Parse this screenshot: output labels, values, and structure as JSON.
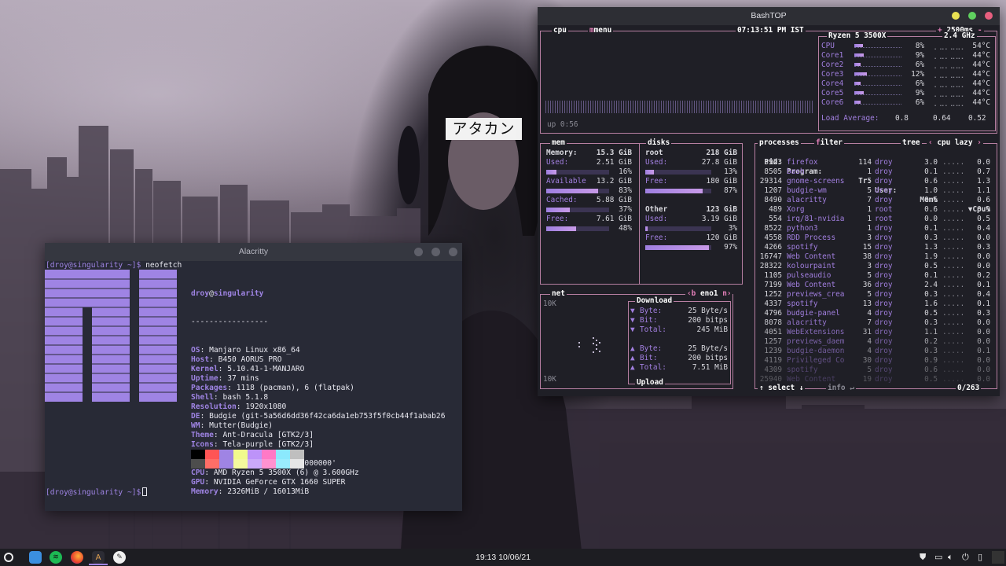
{
  "wallpaper": {
    "tag_text": "アタカン"
  },
  "alacritty": {
    "title": "Alacritty",
    "prompt1": "[droy@singularity ~]$",
    "command": " neofetch",
    "user": "droy",
    "at": "@",
    "host": "singularity",
    "separator": "-----------------",
    "info": [
      {
        "key": "OS",
        "value": "Manjaro Linux x86_64"
      },
      {
        "key": "Host",
        "value": "B450 AORUS PRO"
      },
      {
        "key": "Kernel",
        "value": "5.10.41-1-MANJARO"
      },
      {
        "key": "Uptime",
        "value": "37 mins"
      },
      {
        "key": "Packages",
        "value": "1118 (pacman), 6 (flatpak)"
      },
      {
        "key": "Shell",
        "value": "bash 5.1.8"
      },
      {
        "key": "Resolution",
        "value": "1920x1080"
      },
      {
        "key": "DE",
        "value": "Budgie (git-5a56d6dd36f42ca6da1eb753f5f0cb44f1abab26"
      },
      {
        "key": "WM",
        "value": "Mutter(Budgie)"
      },
      {
        "key": "Theme",
        "value": "Ant-Dracula [GTK2/3]"
      },
      {
        "key": "Icons",
        "value": "Tela-purple [GTK2/3]"
      },
      {
        "key": "Terminal",
        "value": "alacritty"
      },
      {
        "key": "Terminal Font",
        "value": "black: '0x000000'"
      },
      {
        "key": "CPU",
        "value": "AMD Ryzen 5 3500X (6) @ 3.600GHz"
      },
      {
        "key": "GPU",
        "value": "NVIDIA GeForce GTX 1660 SUPER"
      },
      {
        "key": "Memory",
        "value": "2326MiB / 16013MiB"
      }
    ],
    "palette_top": [
      "#000000",
      "#ff5555",
      "#9f84e4",
      "#f1fa8c",
      "#bd93f9",
      "#ff79c6",
      "#8be9fd",
      "#bfbfbf"
    ],
    "palette_bottom": [
      "#4d4d4d",
      "#ff6e67",
      "#9f84e4",
      "#f4f99d",
      "#caa9fa",
      "#ff92d0",
      "#9aedfe",
      "#e6e6e6"
    ],
    "prompt2": "[droy@singularity ~]$"
  },
  "bashtop": {
    "title": "BashTOP",
    "cpu_label": "cpu",
    "menu_label": "menu",
    "clock": "07:13:51 PM IST",
    "refresh": "2500ms",
    "refresh_minus": "-",
    "refresh_plus": "+",
    "cpu_model": "Ryzen 5 3500X",
    "cpu_freq": "2.4 GHz",
    "uptime": "up 0:56",
    "cores": [
      {
        "name": "CPU",
        "pct": "8%",
        "temp": "54°C",
        "load": 0.08
      },
      {
        "name": "Core1",
        "pct": "9%",
        "temp": "44°C",
        "load": 0.09
      },
      {
        "name": "Core2",
        "pct": "6%",
        "temp": "44°C",
        "load": 0.06
      },
      {
        "name": "Core3",
        "pct": "12%",
        "temp": "44°C",
        "load": 0.12
      },
      {
        "name": "Core4",
        "pct": "6%",
        "temp": "44°C",
        "load": 0.06
      },
      {
        "name": "Core5",
        "pct": "9%",
        "temp": "44°C",
        "load": 0.09
      },
      {
        "name": "Core6",
        "pct": "6%",
        "temp": "44°C",
        "load": 0.06
      }
    ],
    "load_avg_label": "Load Average:",
    "load_avg": [
      "0.8",
      "0.64",
      "0.52"
    ],
    "mem": {
      "label": "mem",
      "memory_label": "Memory:",
      "memory_total": "15.3 GiB",
      "rows": [
        {
          "label": "Used:",
          "value": "2.51 GiB",
          "pct": "16%",
          "fill": 0.16
        },
        {
          "label": "Available",
          "value": "13.2 GiB",
          "pct": "83%",
          "fill": 0.83
        },
        {
          "label": "Cached:",
          "value": "5.88 GiB",
          "pct": "37%",
          "fill": 0.37
        },
        {
          "label": "Free:",
          "value": "7.61 GiB",
          "pct": "48%",
          "fill": 0.48
        }
      ]
    },
    "disks": {
      "label": "disks",
      "root": {
        "name": "root",
        "total": "218 GiB",
        "used_label": "Used:",
        "used": "27.8 GiB",
        "used_pct": "13%",
        "used_fill": 0.13,
        "free_label": "Free:",
        "free": "180 GiB",
        "free_pct": "87%",
        "free_fill": 0.87
      },
      "other": {
        "name": "Other",
        "total": "123 GiB",
        "used_label": "Used:",
        "used": "3.19 GiB",
        "used_pct": "3%",
        "used_fill": 0.03,
        "free_label": "Free:",
        "free": "120 GiB",
        "free_pct": "97%",
        "free_fill": 0.97
      }
    },
    "net": {
      "label": "net",
      "iface_prev": "‹b",
      "iface": "eno1",
      "iface_next": "n›",
      "scale_top": "10K",
      "scale_bottom": "10K",
      "download_label": "Download",
      "upload_label": "Upload",
      "down": [
        {
          "arrow": "▼",
          "label": "Byte:",
          "value": "25 Byte/s"
        },
        {
          "arrow": "▼",
          "label": "Bit:",
          "value": "200 bitps"
        },
        {
          "arrow": "▼",
          "label": "Total:",
          "value": "245 MiB"
        }
      ],
      "up": [
        {
          "arrow": "▲",
          "label": "Byte:",
          "value": "25 Byte/s"
        },
        {
          "arrow": "▲",
          "label": "Bit:",
          "value": "200 bitps"
        },
        {
          "arrow": "▲",
          "label": "Total:",
          "value": "7.51 MiB"
        }
      ]
    },
    "proc": {
      "label": "processes",
      "filter": "filter",
      "tree": "tree",
      "sort_prev": "‹",
      "sort": "cpu lazy",
      "sort_next": "›",
      "headers": {
        "pid": "Pid:",
        "program": "Program:",
        "tr": "Tr:",
        "user": "User:",
        "mem": "Mem%",
        "cpu": "▼Cpu%"
      },
      "rows": [
        {
          "pid": "3923",
          "program": "firefox",
          "tr": "114",
          "user": "droy",
          "mem": "3.0",
          "cpu": "0.0"
        },
        {
          "pid": "8505",
          "program": "bash",
          "tr": "1",
          "user": "droy",
          "mem": "0.1",
          "cpu": "0.7"
        },
        {
          "pid": "29314",
          "program": "gnome-screens",
          "tr": "5",
          "user": "droy",
          "mem": "0.6",
          "cpu": "1.3"
        },
        {
          "pid": "1207",
          "program": "budgie-wm",
          "tr": "5",
          "user": "droy",
          "mem": "1.0",
          "cpu": "1.1"
        },
        {
          "pid": "8490",
          "program": "alacritty",
          "tr": "7",
          "user": "droy",
          "mem": "0.6",
          "cpu": "0.6"
        },
        {
          "pid": "489",
          "program": "Xorg",
          "tr": "1",
          "user": "root",
          "mem": "0.6",
          "cpu": "0.9"
        },
        {
          "pid": "554",
          "program": "irq/81-nvidia",
          "tr": "1",
          "user": "root",
          "mem": "0.0",
          "cpu": "0.5"
        },
        {
          "pid": "8522",
          "program": "python3",
          "tr": "1",
          "user": "droy",
          "mem": "0.1",
          "cpu": "0.4"
        },
        {
          "pid": "4558",
          "program": "RDD Process",
          "tr": "3",
          "user": "droy",
          "mem": "0.3",
          "cpu": "0.0"
        },
        {
          "pid": "4266",
          "program": "spotify",
          "tr": "15",
          "user": "droy",
          "mem": "1.3",
          "cpu": "0.3"
        },
        {
          "pid": "16747",
          "program": "Web Content",
          "tr": "38",
          "user": "droy",
          "mem": "1.9",
          "cpu": "0.0"
        },
        {
          "pid": "28322",
          "program": "kolourpaint",
          "tr": "3",
          "user": "droy",
          "mem": "0.5",
          "cpu": "0.0"
        },
        {
          "pid": "1105",
          "program": "pulseaudio",
          "tr": "5",
          "user": "droy",
          "mem": "0.1",
          "cpu": "0.2"
        },
        {
          "pid": "7199",
          "program": "Web Content",
          "tr": "36",
          "user": "droy",
          "mem": "2.4",
          "cpu": "0.1"
        },
        {
          "pid": "1252",
          "program": "previews_crea",
          "tr": "5",
          "user": "droy",
          "mem": "0.3",
          "cpu": "0.4"
        },
        {
          "pid": "4337",
          "program": "spotify",
          "tr": "13",
          "user": "droy",
          "mem": "1.6",
          "cpu": "0.1"
        },
        {
          "pid": "4796",
          "program": "budgie-panel",
          "tr": "4",
          "user": "droy",
          "mem": "0.5",
          "cpu": "0.3"
        },
        {
          "pid": "8078",
          "program": "alacritty",
          "tr": "7",
          "user": "droy",
          "mem": "0.3",
          "cpu": "0.0"
        },
        {
          "pid": "4051",
          "program": "WebExtensions",
          "tr": "31",
          "user": "droy",
          "mem": "1.1",
          "cpu": "0.0"
        },
        {
          "pid": "1257",
          "program": "previews_daem",
          "tr": "4",
          "user": "droy",
          "mem": "0.2",
          "cpu": "0.0"
        },
        {
          "pid": "1239",
          "program": "budgie-daemon",
          "tr": "4",
          "user": "droy",
          "mem": "0.3",
          "cpu": "0.1"
        },
        {
          "pid": "4119",
          "program": "Privileged Co",
          "tr": "30",
          "user": "droy",
          "mem": "0.9",
          "cpu": "0.0"
        },
        {
          "pid": "4309",
          "program": "spotify",
          "tr": "5",
          "user": "droy",
          "mem": "0.6",
          "cpu": "0.0"
        },
        {
          "pid": "25940",
          "program": "Web Content",
          "tr": "19",
          "user": "droy",
          "mem": "0.5",
          "cpu": "0.0"
        }
      ],
      "select_label": "↑ select ↓",
      "info_label": "info ↵",
      "count": "0/263"
    }
  },
  "panel": {
    "clock": "19:13 10/06/21",
    "apps": [
      "files-icon",
      "spotify-icon",
      "firefox-icon",
      "alacritty-icon",
      "kolourpaint-icon"
    ],
    "tray": [
      "shield-icon",
      "display-icon",
      "volume-icon",
      "power-icon",
      "notifications-icon"
    ]
  }
}
